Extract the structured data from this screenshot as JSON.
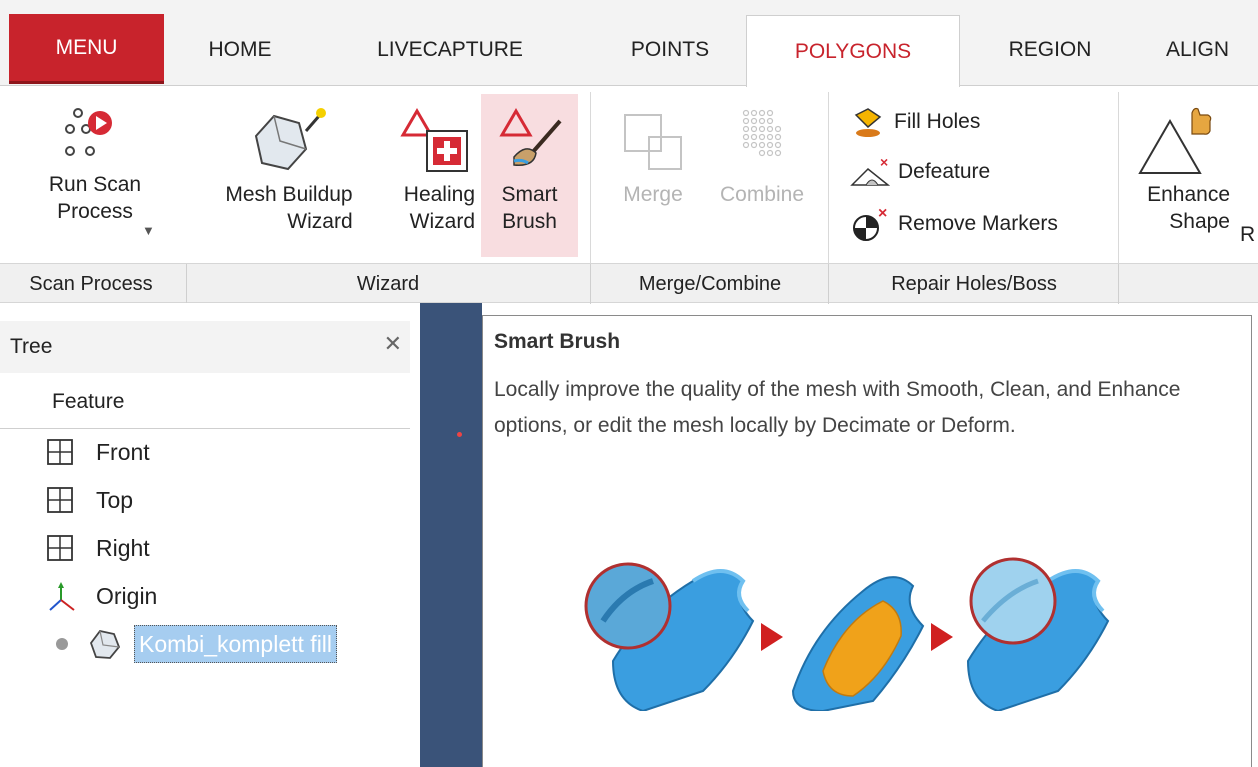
{
  "tabs": [
    {
      "label": "MENU"
    },
    {
      "label": "HOME"
    },
    {
      "label": "LIVECAPTURE"
    },
    {
      "label": "POINTS"
    },
    {
      "label": "POLYGONS"
    },
    {
      "label": "REGION"
    },
    {
      "label": "ALIGN"
    }
  ],
  "active_tab": "POLYGONS",
  "ribbon": {
    "run_scan": "Run Scan\nProcess",
    "mesh_buildup": "Mesh Buildup\nWizard",
    "healing": "Healing\nWizard",
    "smart_brush": "Smart\nBrush",
    "merge": "Merge",
    "combine": "Combine",
    "fill_holes": "Fill Holes",
    "defeature": "Defeature",
    "remove_markers": "Remove Markers",
    "enhance_shape": "Enhance\nShape",
    "partial_next": "R"
  },
  "groups": [
    "Scan Process",
    "Wizard",
    "Merge/Combine",
    "Repair Holes/Boss"
  ],
  "tree": {
    "title": "Tree",
    "column": "Feature",
    "items": [
      "Front",
      "Top",
      "Right",
      "Origin",
      "Kombi_komplett fill"
    ]
  },
  "tooltip": {
    "title": "Smart Brush",
    "body": "Locally improve the quality of the mesh with Smooth, Clean, and Enhance options, or edit the mesh locally by Decimate or Deform."
  },
  "colors": {
    "menu_red": "#c8232c",
    "accent_red": "#c8232c",
    "selection_blue": "#a6cdf0",
    "viewport_blue": "#3a5379",
    "mesh_blue": "#3a9ee0",
    "mesh_orange": "#f0a21a"
  }
}
